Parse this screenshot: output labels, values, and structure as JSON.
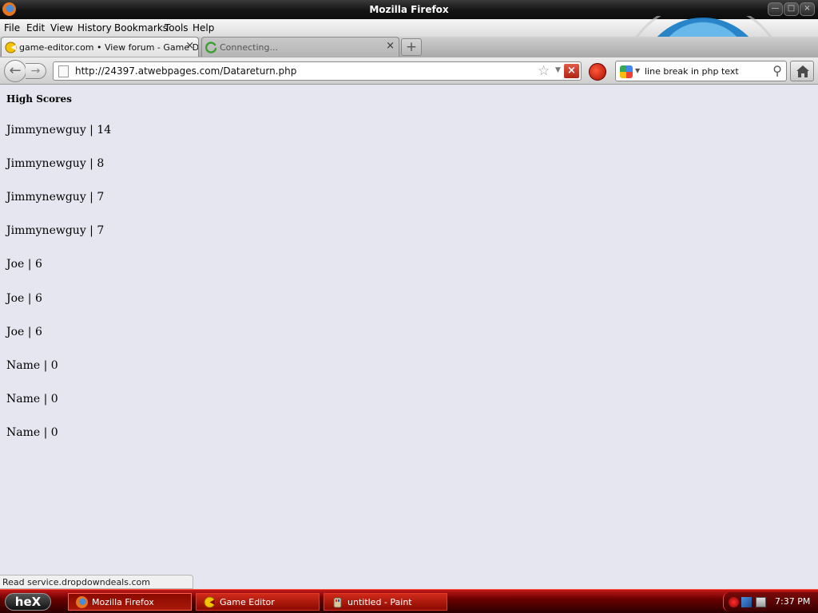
{
  "window": {
    "title": "Mozilla Firefox",
    "icon": "firefox-logo-icon",
    "controls": [
      "minimize-icon",
      "maximize-icon",
      "close-icon"
    ]
  },
  "menu": [
    "File",
    "Edit",
    "View",
    "History",
    "Bookmarks",
    "Tools",
    "Help"
  ],
  "tabs": [
    {
      "label": "game-editor.com • View forum - Game De...",
      "close": "×",
      "icon": "game-editor-favicon-icon",
      "state": "active"
    },
    {
      "label": "Connecting...",
      "close": "×",
      "icon": "loading-spinner-icon",
      "state": "inactive"
    }
  ],
  "navbar": {
    "url": "http://24397.atwebpages.com/Datareturn.php",
    "search_query": "line break in php text",
    "search_engine_icon": "google-icon",
    "icons": [
      "back-arrow-icon",
      "forward-arrow-icon",
      "page-icon",
      "bookmark-star-icon",
      "stop-icon",
      "addon-icon",
      "magnifier-icon",
      "home-icon"
    ]
  },
  "content": {
    "heading": "High Scores",
    "scores": [
      "Jimmynewguy | 14",
      "Jimmynewguy | 8",
      "Jimmynewguy | 7",
      "Jimmynewguy | 7",
      "Joe | 6",
      "Joe | 6",
      "Joe | 6",
      "Name | 0",
      "Name | 0",
      "Name | 0"
    ]
  },
  "status": "Read service.dropdowndeals.com",
  "taskbar": {
    "start_label": "heX",
    "tasks": [
      {
        "label": "Mozilla Firefox",
        "icon": "firefox-icon",
        "state": "active"
      },
      {
        "label": "Game Editor",
        "icon": "game-editor-icon",
        "state": "normal"
      },
      {
        "label": "untitled - Paint",
        "icon": "paint-icon",
        "state": "normal"
      }
    ],
    "tray_icons": [
      "record-icon",
      "network-icon",
      "volume-icon"
    ],
    "clock": "7:37 PM"
  },
  "colors": {
    "page_background": "#e6e6f0",
    "taskbar_red": "#c01818",
    "titlebar_dark": "#141414"
  }
}
